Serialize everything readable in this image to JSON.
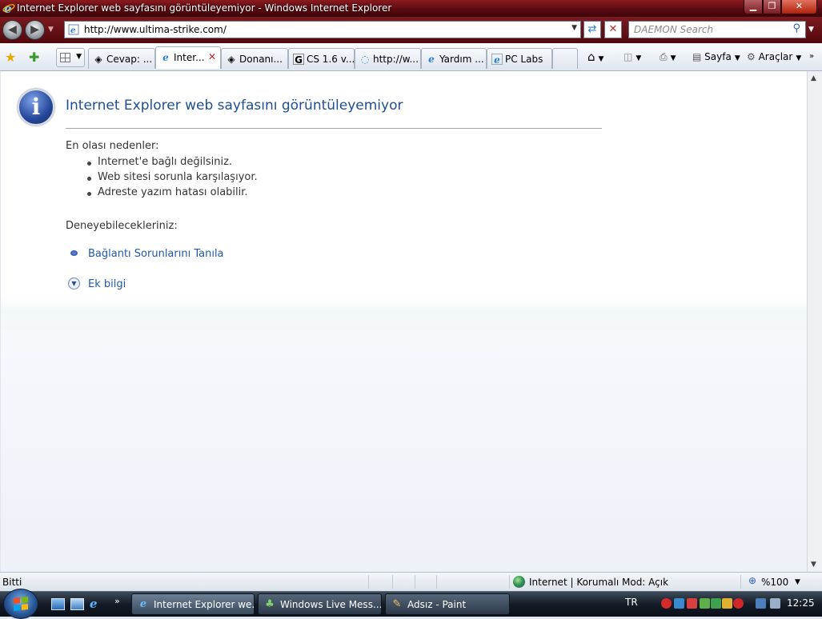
{
  "window": {
    "title": "Internet Explorer web sayfasını görüntüleyemiyor - Windows Internet Explorer",
    "minimize_icon": "minimize-icon",
    "maximize_icon": "restore-icon",
    "close_icon": "close-icon"
  },
  "navigation": {
    "address_url": "http://www.ultima-strike.com/",
    "search_placeholder": "DAEMON Search"
  },
  "tabs": [
    {
      "label": "Cevap: ...",
      "icon": "forum-icon",
      "active": false
    },
    {
      "label": "Inter...",
      "icon": "ie-icon",
      "active": true
    },
    {
      "label": "Donanı...",
      "icon": "forum-icon",
      "active": false
    },
    {
      "label": "CS 1.6 v...",
      "icon": "google-icon",
      "active": false
    },
    {
      "label": "http://w...",
      "icon": "loading-icon",
      "active": false
    },
    {
      "label": "Yardım ...",
      "icon": "ie-icon",
      "active": false
    },
    {
      "label": "PC Labs",
      "icon": "page-icon",
      "active": false
    }
  ],
  "commandbar": {
    "page_label": "Sayfa",
    "tools_label": "Araçlar"
  },
  "error_page": {
    "title": "Internet Explorer web sayfasını görüntüleyemiyor",
    "causes_heading": "En olası nedenler:",
    "causes": [
      "Internet'e bağlı değilsiniz.",
      "Web sitesi sorunla karşılaşıyor.",
      "Adreste yazım hatası olabilir."
    ],
    "try_heading": "Deneyebilecekleriniz:",
    "diagnose_link": "Bağlantı Sorunlarını Tanıla",
    "more_info_link": "Ek bilgi"
  },
  "statusbar": {
    "status": "Bitti",
    "zone": "Internet | Korumalı Mod: Açık",
    "zoom": "%100"
  },
  "taskbar": {
    "tasks": [
      {
        "label": "Internet Explorer we...",
        "icon": "ie-icon",
        "active": true
      },
      {
        "label": "Windows Live Mess...",
        "icon": "messenger-icon",
        "active": false
      },
      {
        "label": "Adsız - Paint",
        "icon": "paint-icon",
        "active": false
      }
    ],
    "language": "TR",
    "clock": "12:25"
  },
  "colors": {
    "titlebar": "#5a0b10",
    "link": "#1f5aa6",
    "error_title": "#1f4f90"
  }
}
